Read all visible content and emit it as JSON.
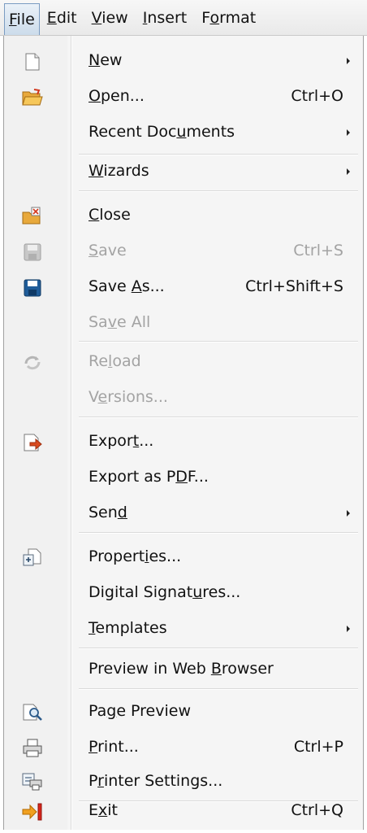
{
  "menubar": {
    "items": [
      {
        "pre": "",
        "u": "F",
        "post": "ile"
      },
      {
        "pre": "",
        "u": "E",
        "post": "dit"
      },
      {
        "pre": "",
        "u": "V",
        "post": "iew"
      },
      {
        "pre": "",
        "u": "I",
        "post": "nsert"
      },
      {
        "pre": "F",
        "u": "o",
        "post": "rmat"
      }
    ]
  },
  "menu": {
    "items": [
      {
        "pre": "",
        "u": "N",
        "post": "ew",
        "shortcut": "",
        "icon": "new-document-icon",
        "submenu": true,
        "disabled": false
      },
      {
        "pre": "",
        "u": "O",
        "post": "pen...",
        "shortcut": "Ctrl+O",
        "icon": "open-folder-icon",
        "submenu": false,
        "disabled": false
      },
      {
        "pre": "Recent Doc",
        "u": "u",
        "post": "ments",
        "shortcut": "",
        "icon": "",
        "submenu": true,
        "disabled": false
      },
      {
        "pre": "",
        "u": "W",
        "post": "izards",
        "shortcut": "",
        "icon": "",
        "submenu": true,
        "disabled": false
      },
      {
        "pre": "",
        "u": "C",
        "post": "lose",
        "shortcut": "",
        "icon": "close-document-icon",
        "submenu": false,
        "disabled": false
      },
      {
        "pre": "",
        "u": "S",
        "post": "ave",
        "shortcut": "Ctrl+S",
        "icon": "save-icon",
        "submenu": false,
        "disabled": true
      },
      {
        "pre": "Save ",
        "u": "A",
        "post": "s...",
        "shortcut": "Ctrl+Shift+S",
        "icon": "save-as-icon",
        "submenu": false,
        "disabled": false
      },
      {
        "pre": "Sa",
        "u": "v",
        "post": "e All",
        "shortcut": "",
        "icon": "",
        "submenu": false,
        "disabled": true
      },
      {
        "pre": "Re",
        "u": "l",
        "post": "oad",
        "shortcut": "",
        "icon": "reload-icon",
        "submenu": false,
        "disabled": true
      },
      {
        "pre": "V",
        "u": "e",
        "post": "rsions...",
        "shortcut": "",
        "icon": "",
        "submenu": false,
        "disabled": true
      },
      {
        "pre": "Expor",
        "u": "t",
        "post": "...",
        "shortcut": "",
        "icon": "export-icon",
        "submenu": false,
        "disabled": false
      },
      {
        "pre": "Export as P",
        "u": "D",
        "post": "F...",
        "shortcut": "",
        "icon": "",
        "submenu": false,
        "disabled": false
      },
      {
        "pre": "Sen",
        "u": "d",
        "post": "",
        "shortcut": "",
        "icon": "",
        "submenu": true,
        "disabled": false
      },
      {
        "pre": "Propert",
        "u": "i",
        "post": "es...",
        "shortcut": "",
        "icon": "properties-icon",
        "submenu": false,
        "disabled": false
      },
      {
        "pre": "Digital Signat",
        "u": "u",
        "post": "res...",
        "shortcut": "",
        "icon": "",
        "submenu": false,
        "disabled": false
      },
      {
        "pre": "",
        "u": "T",
        "post": "emplates",
        "shortcut": "",
        "icon": "",
        "submenu": true,
        "disabled": false
      },
      {
        "pre": "Preview in Web ",
        "u": "B",
        "post": "rowser",
        "shortcut": "",
        "icon": "",
        "submenu": false,
        "disabled": false
      },
      {
        "pre": "Pa",
        "u": "g",
        "post": "e Preview",
        "shortcut": "",
        "icon": "page-preview-icon",
        "submenu": false,
        "disabled": false
      },
      {
        "pre": "",
        "u": "P",
        "post": "rint...",
        "shortcut": "Ctrl+P",
        "icon": "printer-icon",
        "submenu": false,
        "disabled": false
      },
      {
        "pre": "P",
        "u": "r",
        "post": "inter Settings...",
        "shortcut": "",
        "icon": "printer-settings-icon",
        "submenu": false,
        "disabled": false
      },
      {
        "pre": "E",
        "u": "x",
        "post": "it",
        "shortcut": "Ctrl+Q",
        "icon": "exit-icon",
        "submenu": false,
        "disabled": false
      }
    ]
  }
}
